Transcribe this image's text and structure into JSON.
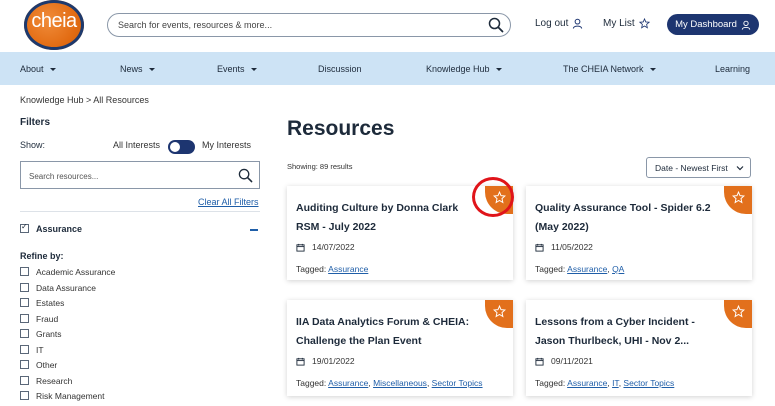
{
  "header": {
    "logo_text": "cheia",
    "search_placeholder": "Search for events, resources & more...",
    "logout_label": "Log out",
    "mylist_label": "My List",
    "dashboard_label": "My Dashboard"
  },
  "nav": {
    "items": [
      {
        "label": "About",
        "dropdown": true
      },
      {
        "label": "News",
        "dropdown": true
      },
      {
        "label": "Events",
        "dropdown": true
      },
      {
        "label": "Discussion",
        "dropdown": false
      },
      {
        "label": "Knowledge Hub",
        "dropdown": true
      },
      {
        "label": "The CHEIA Network",
        "dropdown": true
      },
      {
        "label": "Learning",
        "dropdown": false
      }
    ]
  },
  "breadcrumb": "Knowledge Hub > All Resources",
  "sidebar": {
    "title": "Filters",
    "show_label": "Show:",
    "all_interests": "All Interests",
    "my_interests": "My Interests",
    "search_placeholder": "Search resources...",
    "clear_all": "Clear All Filters",
    "assurance_label": "Assurance",
    "refine_label": "Refine by:",
    "refine_items": [
      "Academic Assurance",
      "Data Assurance",
      "Estates",
      "Fraud",
      "Grants",
      "IT",
      "Other",
      "Research",
      "Risk Management"
    ]
  },
  "main": {
    "title": "Resources",
    "showing": "Showing: 89 results",
    "sort_value": "Date - Newest First",
    "cards": [
      {
        "title": "Auditing Culture by Donna Clark RSM - July 2022",
        "date": "14/07/2022",
        "tagged_label": "Tagged:",
        "tags": [
          "Assurance"
        ]
      },
      {
        "title": "Quality Assurance Tool - Spider 6.2 (May 2022)",
        "date": "11/05/2022",
        "tagged_label": "Tagged:",
        "tags": [
          "Assurance",
          "QA"
        ]
      },
      {
        "title": "IIA Data Analytics Forum & CHEIA: Challenge the Plan Event",
        "date": "19/01/2022",
        "tagged_label": "Tagged:",
        "tags": [
          "Assurance",
          "Miscellaneous",
          "Sector Topics"
        ]
      },
      {
        "title": "Lessons from a Cyber Incident - Jason Thurlbeck, UHI - Nov 2...",
        "date": "09/11/2021",
        "tagged_label": "Tagged:",
        "tags": [
          "Assurance",
          "IT",
          "Sector Topics"
        ]
      }
    ]
  },
  "colors": {
    "navy": "#1d3570",
    "orange": "#e2701c",
    "nav_bg": "#cde3f5",
    "link": "#1f5ea8",
    "highlight": "#e0141a"
  }
}
